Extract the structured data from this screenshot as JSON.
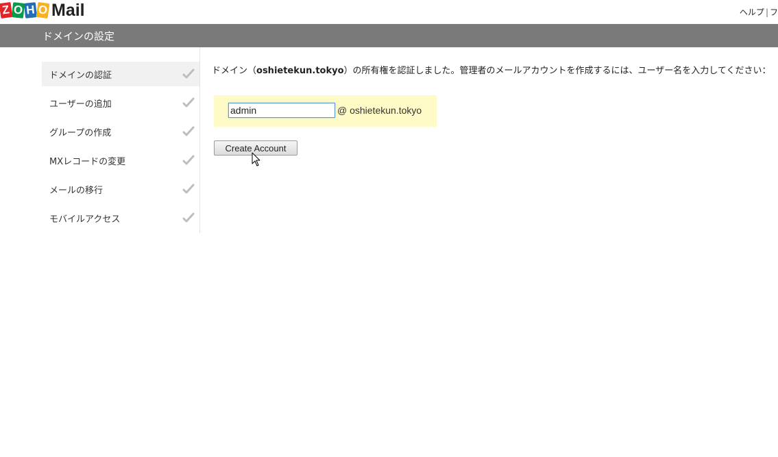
{
  "header": {
    "logo_letters": [
      "Z",
      "O",
      "H",
      "O"
    ],
    "logo_colors": [
      "#e42527",
      "#089949",
      "#226db4",
      "#f9b21d"
    ],
    "app_name": "Mail",
    "links": [
      "ヘルプ",
      "フ"
    ]
  },
  "titlebar": {
    "title": "ドメインの設定",
    "bg_color": "#7a7a7a"
  },
  "sidebar": {
    "items": [
      {
        "label": "ドメインの認証",
        "icon": "check-icon",
        "active": true
      },
      {
        "label": "ユーザーの追加",
        "icon": "check-icon",
        "active": false
      },
      {
        "label": "グループの作成",
        "icon": "check-icon",
        "active": false
      },
      {
        "label": "MXレコードの変更",
        "icon": "check-icon",
        "active": false
      },
      {
        "label": "メールの移行",
        "icon": "check-icon",
        "active": false
      },
      {
        "label": "モバイルアクセス",
        "icon": "check-icon",
        "active": false
      }
    ]
  },
  "main": {
    "intro_prefix": "ドメイン（",
    "intro_domain": "oshietekun.tokyo",
    "intro_suffix": "）の所有権を認証しました。管理者のメールアカウントを作成するには、ユーザー名を入力してください：",
    "username_value": "admin",
    "domain_label": "@ oshietekun.tokyo",
    "create_button": "Create Account",
    "highlight_color": "#fefbc6"
  }
}
